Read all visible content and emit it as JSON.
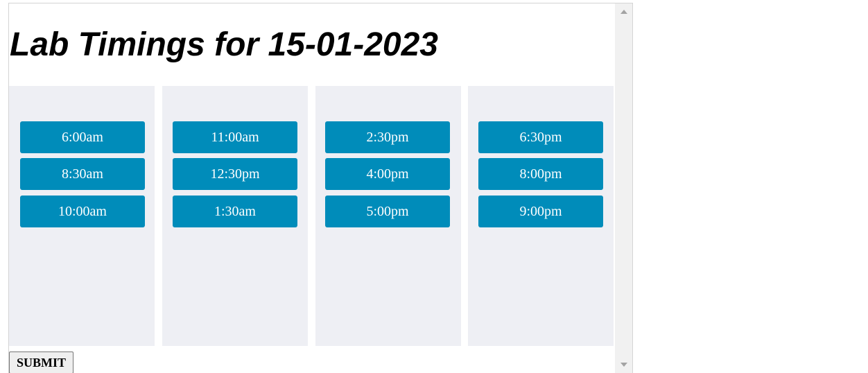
{
  "page": {
    "title": "Lab Timings for 15-01-2023"
  },
  "columns": [
    {
      "slots": [
        "6:00am",
        "8:30am",
        "10:00am"
      ]
    },
    {
      "slots": [
        "11:00am",
        "12:30pm",
        "1:30am"
      ]
    },
    {
      "slots": [
        "2:30pm",
        "4:00pm",
        "5:00pm"
      ]
    },
    {
      "slots": [
        "6:30pm",
        "8:00pm",
        "9:00pm"
      ]
    }
  ],
  "form": {
    "submit_label": "SUBMIT"
  },
  "colors": {
    "slot_button": "#008cba",
    "column_background": "#eeeff4"
  }
}
